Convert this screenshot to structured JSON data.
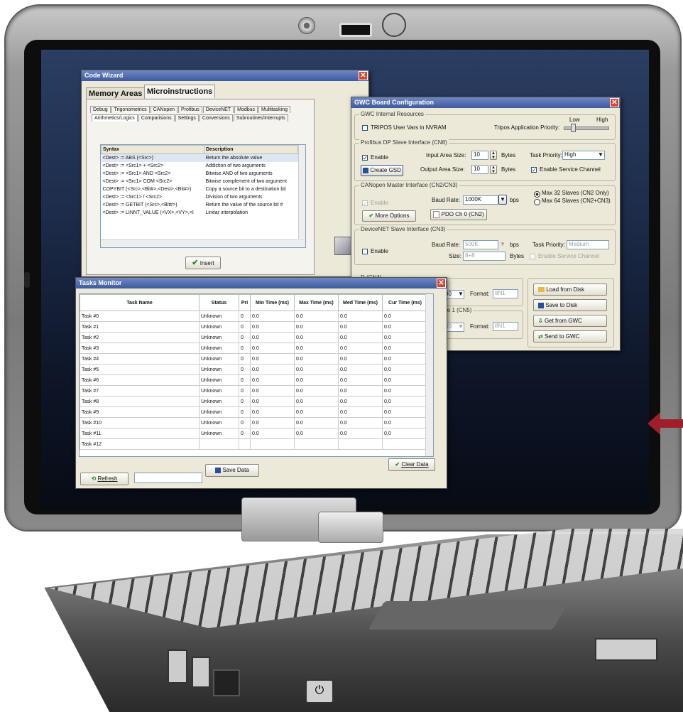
{
  "code_wizard": {
    "title": "Code Wizard",
    "top_tabs": [
      "Memory Areas",
      "Microinstructions"
    ],
    "sub_tabs_row1": [
      "Debug",
      "Trigonometrics",
      "CANopen",
      "Profibus",
      "DeviceNET",
      "Modbus",
      "Multitasking"
    ],
    "sub_tabs_row2": [
      "Arithmetics/Logics",
      "Comparisions",
      "Settings",
      "Conversions",
      "Subroutines/Interrupts"
    ],
    "columns": [
      "Syntax",
      "Description"
    ],
    "rows": [
      [
        "<Dest> := ABS (<Src>)",
        "Return the absolute value"
      ],
      [
        "<Dest> := <Src1> + <Src2>",
        "Addiction of two arguments"
      ],
      [
        "<Dest> := <Src1> AND <Src2>",
        "Bitwise AND of two arguments"
      ],
      [
        "<Dest> := <Src1> COM <Src2>",
        "Bitwise complement of two argument"
      ],
      [
        "COPYBIT (<Src>,<Bit#>,<Dest>,<Bit#>)",
        "Copy a source bit to a destination bit"
      ],
      [
        "<Dest> := <Src1> / <Src2>",
        "Division of two arguments"
      ],
      [
        "<Dest> := GETBIT (<Src>,<Bit#>)",
        "Return the value of the source bit #"
      ],
      [
        "<Dest> := LINNT_VALUE (<VX>,<VY>,<I",
        "Linear interpolation"
      ]
    ],
    "insert_label": "Insert"
  },
  "gwc": {
    "title": "GWC Board Configuration",
    "internal": {
      "label": "GWC Internal Resources",
      "tripos_label": "TRIPOS User Vars in NVRAM",
      "priority_label": "Tripos Application Priority:",
      "low": "Low",
      "high": "High"
    },
    "profibus": {
      "label": "Profibus DP Slave Interface (CN8)",
      "enable": "Enable",
      "input_size_label": "Input Area Size:",
      "input_size": "10",
      "output_size_label": "Output Area Size:",
      "output_size": "10",
      "bytes": "Bytes",
      "task_priority_label": "Task Priority:",
      "task_priority": "High",
      "create_gsd": "Create GSD",
      "enable_service": "Enable Service Channel"
    },
    "canopen": {
      "label": "CANopen Master Interface (CN2/CN3)",
      "enable": "Enable",
      "baud_label": "Baud Rate:",
      "baud": "1000K",
      "bps": "bps",
      "max32": "Max 32 Slaves (CN2 Only)",
      "max64": "Max 64 Slaves (CN2+CN3)",
      "more_options": "More Options",
      "pdo": "PDO Ch 0 (CN2)"
    },
    "devicenet": {
      "label": "DeviceNET Slave Interface (CN3)",
      "enable": "Enable",
      "baud_label": "Baud Rate:",
      "baud": "500K",
      "bps": "bps",
      "task_priority_label": "Task Priority:",
      "task_priority": "Medium",
      "size_label": "Size:",
      "size": "8+8",
      "bytes": "Bytes",
      "enable_service": "Enable Service Channel"
    },
    "serial1": {
      "label": "D (CN4)",
      "value": "00",
      "format_label": "Format:",
      "format": "8N1"
    },
    "serial2": {
      "label": "erface 1 (CN5)",
      "value": "00",
      "format_label": "Format:",
      "format": "8N1"
    },
    "load_disk": "Load from Disk",
    "save_disk": "Save to Disk",
    "get_gwc": "Get from GWC",
    "send_gwc": "Send to GWC"
  },
  "tasks": {
    "title": "Tasks Monitor",
    "columns": [
      "Task Name",
      "Status",
      "Pri",
      "Min Time (ms)",
      "Max Time (ms)",
      "Med Time (ms)",
      "Cur Time (ms)"
    ],
    "rows": [
      [
        "Task #0",
        "Unknown",
        "0",
        "0.0",
        "0.0",
        "0.0",
        "0.0"
      ],
      [
        "Task #1",
        "Unknown",
        "0",
        "0.0",
        "0.0",
        "0.0",
        "0.0"
      ],
      [
        "Task #2",
        "Unknown",
        "0",
        "0.0",
        "0.0",
        "0.0",
        "0.0"
      ],
      [
        "Task #3",
        "Unknown",
        "0",
        "0.0",
        "0.0",
        "0.0",
        "0.0"
      ],
      [
        "Task #4",
        "Unknown",
        "0",
        "0.0",
        "0.0",
        "0.0",
        "0.0"
      ],
      [
        "Task #5",
        "Unknown",
        "0",
        "0.0",
        "0.0",
        "0.0",
        "0.0"
      ],
      [
        "Task #6",
        "Unknown",
        "0",
        "0.0",
        "0.0",
        "0.0",
        "0.0"
      ],
      [
        "Task #7",
        "Unknown",
        "0",
        "0.0",
        "0.0",
        "0.0",
        "0.0"
      ],
      [
        "Task #8",
        "Unknown",
        "0",
        "0.0",
        "0.0",
        "0.0",
        "0.0"
      ],
      [
        "Task #9",
        "Unknown",
        "0",
        "0.0",
        "0.0",
        "0.0",
        "0.0"
      ],
      [
        "Task #10",
        "Unknown",
        "0",
        "0.0",
        "0.0",
        "0.0",
        "0.0"
      ],
      [
        "Task #11",
        "Unknown",
        "0",
        "0.0",
        "0.0",
        "0.0",
        "0.0"
      ],
      [
        "Task #12",
        "",
        "",
        "",
        "",
        "",
        ""
      ]
    ],
    "clear_data": "Clear Data",
    "refresh": "Refresh",
    "save_data": "Save Data"
  },
  "colors": {
    "arrow": "#a01e2a",
    "titlebar": "#3d5a9e"
  }
}
